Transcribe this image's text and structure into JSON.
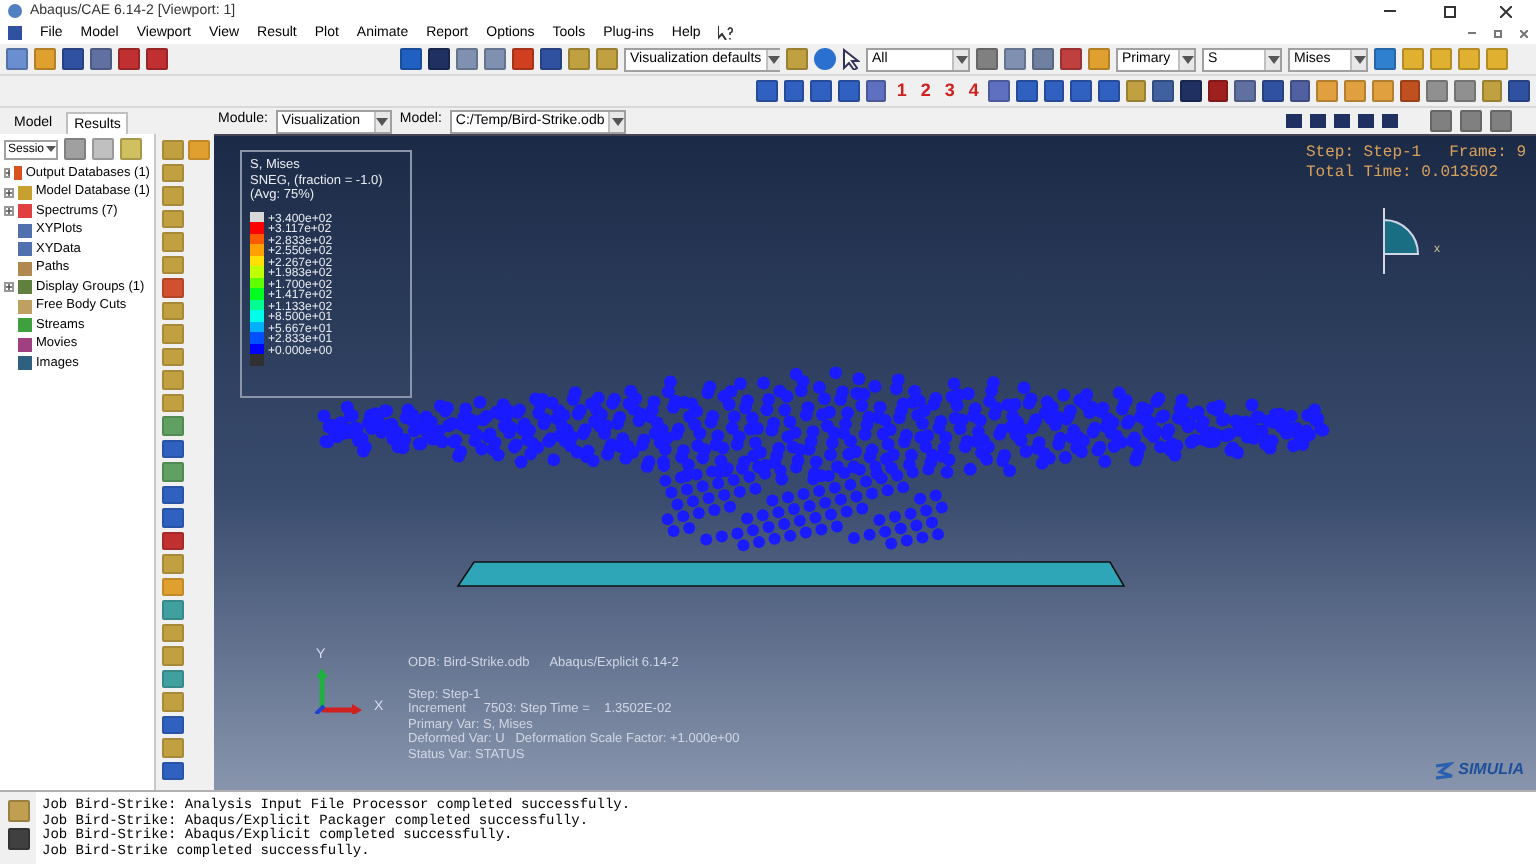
{
  "window": {
    "title": "Abaqus/CAE 6.14-2 [Viewport: 1]"
  },
  "menu": [
    "File",
    "Model",
    "Viewport",
    "View",
    "Result",
    "Plot",
    "Animate",
    "Report",
    "Options",
    "Tools",
    "Plug-ins",
    "Help"
  ],
  "toolbar": {
    "view_defaults": "Visualization defaults",
    "selection": "All",
    "step_numbers": [
      "1",
      "2",
      "3",
      "4"
    ],
    "position": "Primary",
    "variable": "S",
    "invariant": "Mises"
  },
  "context": {
    "module_label": "Module:",
    "module": "Visualization",
    "model_label": "Model:",
    "model": "C:/Temp/Bird-Strike.odb"
  },
  "tabs": [
    {
      "label": "Model",
      "selected": false
    },
    {
      "label": "Results",
      "selected": true
    }
  ],
  "tree": {
    "session": "Sessio",
    "items": [
      {
        "label": "Output Databases (1)",
        "expandable": true,
        "color": "#d9531e"
      },
      {
        "label": "Model Database (1)",
        "expandable": true,
        "color": "#c8a030"
      },
      {
        "label": "Spectrums (7)",
        "expandable": true,
        "color": "#e04040"
      },
      {
        "label": "XYPlots",
        "expandable": false,
        "color": "#5070b0"
      },
      {
        "label": "XYData",
        "expandable": false,
        "color": "#5070b0"
      },
      {
        "label": "Paths",
        "expandable": false,
        "color": "#b08850"
      },
      {
        "label": "Display Groups (1)",
        "expandable": true,
        "color": "#608040"
      },
      {
        "label": "Free Body Cuts",
        "expandable": false,
        "color": "#c0a060"
      },
      {
        "label": "Streams",
        "expandable": false,
        "color": "#40a040"
      },
      {
        "label": "Movies",
        "expandable": false,
        "color": "#a04080"
      },
      {
        "label": "Images",
        "expandable": false,
        "color": "#306080"
      }
    ]
  },
  "legend": {
    "lines": [
      "S, Mises",
      "SNEG, (fraction = -1.0)",
      "(Avg: 75%)"
    ],
    "bands": [
      {
        "color": "#d8d8d8"
      },
      {
        "color": "#ff0000"
      },
      {
        "color": "#ff5a00"
      },
      {
        "color": "#ffa000"
      },
      {
        "color": "#ffe000"
      },
      {
        "color": "#c0ff00"
      },
      {
        "color": "#60ff00"
      },
      {
        "color": "#00ff20"
      },
      {
        "color": "#00ff90"
      },
      {
        "color": "#00ffe8"
      },
      {
        "color": "#00b0ff"
      },
      {
        "color": "#0050ff"
      },
      {
        "color": "#0000ff"
      },
      {
        "color": "#303030"
      }
    ],
    "values": [
      "+3.400e+02",
      "+3.117e+02",
      "+2.833e+02",
      "+2.550e+02",
      "+2.267e+02",
      "+1.983e+02",
      "+1.700e+02",
      "+1.417e+02",
      "+1.133e+02",
      "+8.500e+01",
      "+5.667e+01",
      "+2.833e+01",
      "+0.000e+00"
    ]
  },
  "state": {
    "step": "Step: Step-1",
    "frame": "Frame: 9",
    "total_time": "Total Time: 0.013502"
  },
  "triad": {
    "y": "Y",
    "x": "X",
    "small_x": "x"
  },
  "info": {
    "odb": "ODB: Bird-Strike.odb",
    "solver": "Abaqus/Explicit 6.14-2",
    "lines": [
      "Step: Step-1",
      "Increment     7503: Step Time =    1.3502E-02",
      "Primary Var: S, Mises",
      "Deformed Var: U   Deformation Scale Factor: +1.000e+00",
      "Status Var: STATUS"
    ]
  },
  "brand": "SIMULIA",
  "messages": [
    "Job Bird-Strike: Analysis Input File Processor completed successfully.",
    "Job Bird-Strike: Abaqus/Explicit Packager completed successfully.",
    "Job Bird-Strike: Abaqus/Explicit completed successfully.",
    "Job Bird-Strike completed successfully."
  ]
}
